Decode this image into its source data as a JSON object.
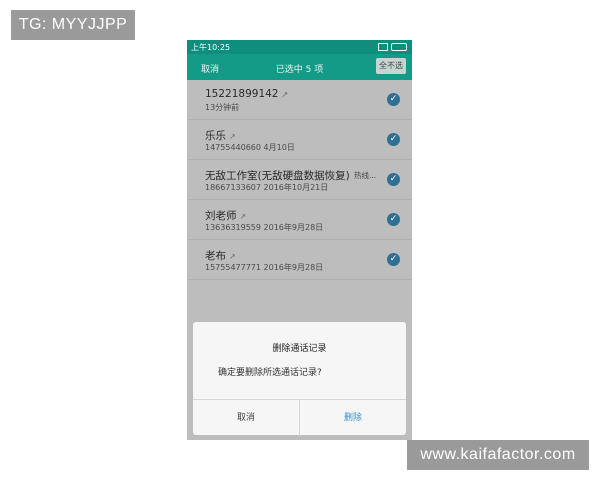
{
  "watermarks": {
    "top": "TG: MYYJJPP",
    "bottom": "www.kaifafactor.com"
  },
  "status_bar": {
    "time": "上午10:25"
  },
  "header": {
    "cancel": "取消",
    "title": "已选中 5 项",
    "select_none": "全不选"
  },
  "calls": [
    {
      "name": "15221899142",
      "detail": "13分钟前",
      "note": "",
      "selected": true
    },
    {
      "name": "乐乐",
      "detail": "14755440660 4月10日",
      "note": "",
      "selected": true
    },
    {
      "name": "无敌工作室(无敌硬盘数据恢复)",
      "detail": "18667133607 2016年10月21日",
      "note": "热线...",
      "selected": true
    },
    {
      "name": "刘老师",
      "detail": "13636319559 2016年9月28日",
      "note": "",
      "selected": true
    },
    {
      "name": "老布",
      "detail": "15755477771 2016年9月28日",
      "note": "",
      "selected": true
    }
  ],
  "dialog": {
    "title": "删除通话记录",
    "message": "确定要删除所选通话记录?",
    "cancel": "取消",
    "confirm": "删除"
  },
  "icons": {
    "call_direction": "outgoing-arrow-icon",
    "selected": "checkmark-icon"
  },
  "colors": {
    "header": "#149b87",
    "status_bar": "#0e8f7e",
    "check": "#2f6f96",
    "confirm_text": "#3c8fd0"
  }
}
